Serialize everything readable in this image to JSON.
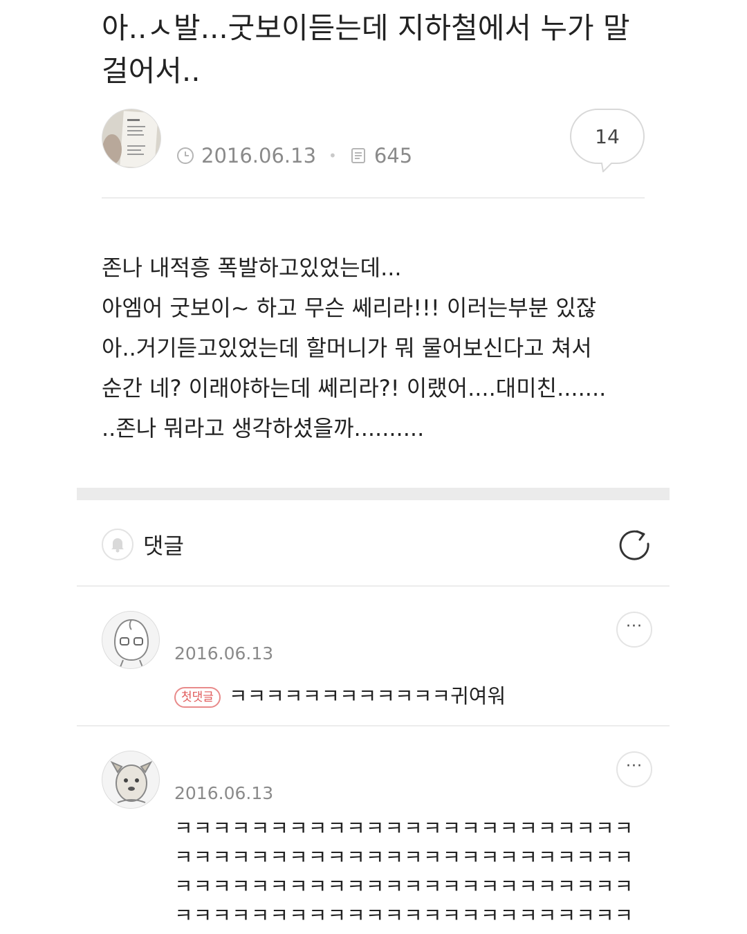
{
  "post": {
    "title": "아..ㅅ발...굿보이듣는데 지하철에서 누가 말 걸어서..",
    "date": "2016.06.13",
    "views": "645",
    "comment_count": "14",
    "body_lines": [
      "존나 내적흥 폭발하고있었는데...",
      "아엠어 굿보이~ 하고 무슨 쎄리라!!! 이러는부분 있잖",
      "아..거기듣고있었는데 할머니가 뭐 물어보신다고 쳐서",
      "순간 네? 이래야하는데 쎄리라?! 이랬어....대미친.......",
      "..존나 뭐라고 생각하셨을까.........."
    ]
  },
  "comments_section": {
    "title": "댓글"
  },
  "comments": [
    {
      "date": "2016.06.13",
      "badge": "첫댓글",
      "text": "ㅋㅋㅋㅋㅋㅋㅋㅋㅋㅋㅋㅋ귀여워",
      "more": "···"
    },
    {
      "date": "2016.06.13",
      "text": "ㅋㅋㅋㅋㅋㅋㅋㅋㅋㅋㅋㅋㅋㅋㅋㅋㅋㅋㅋㅋㅋㅋㅋㅋㅋㅋㅋㅋㅋㅋㅋㅋㅋㅋㅋㅋㅋㅋㅋㅋㅋㅋㅋㅋㅋㅋㅋㅋㅋㅋㅋㅋㅋㅋㅋㅋㅋㅋㅋㅋㅋㅋㅋㅋㅋㅋㅋㅋㅋㅋㅋㅋㅋㅋㅋㅋㅋㅋㅋㅋㅋㅋㅋㅋㅋㅋㅋㅋㅋㅋㅋㅋㅋㅋㅋㅋ",
      "more": "···"
    }
  ],
  "icons": {
    "clock": "clock-icon",
    "views": "document-icon",
    "comment": "speech-bubble-icon",
    "bell": "bell-icon",
    "refresh": "refresh-icon",
    "more": "more-icon"
  },
  "colors": {
    "badge": "#e05a5a",
    "muted": "#8a8a8a",
    "divider": "#ececec"
  }
}
